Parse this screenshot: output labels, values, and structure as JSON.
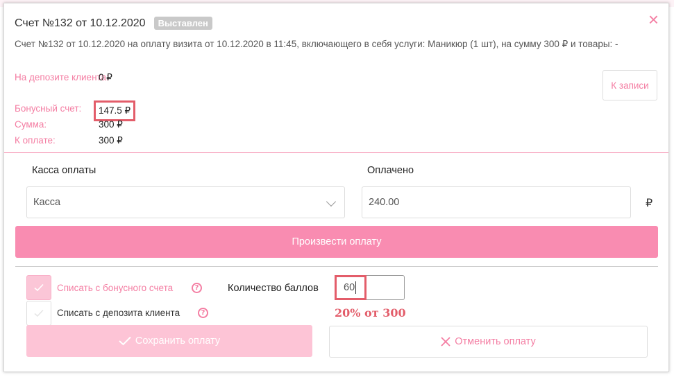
{
  "modal": {
    "title": "Счет №132 от 10.12.2020",
    "status_badge": "Выставлен",
    "close_symbol": "×",
    "description": "Счет №132 от 10.12.2020 на оплату визита от 10.12.2020 в 11:45, включающего в себя услуги: Маникюр (1 шт), на сумму 300 ₽ и товары: -",
    "to_record_button": "К записи"
  },
  "summary": {
    "deposit_label": "На депозите клиента:",
    "deposit_value": "0 ₽",
    "bonus_label": "Бонусный счет:",
    "bonus_value": "147.5 ₽",
    "sum_label": "Сумма:",
    "sum_value": "300 ₽",
    "to_pay_label": "К оплате:",
    "to_pay_value": "300 ₽"
  },
  "payment": {
    "cashbox_label": "Касса оплаты",
    "cashbox_selected": "Касса",
    "paid_label": "Оплачено",
    "paid_value": "240.00",
    "currency": "₽",
    "pay_button": "Произвести оплату"
  },
  "options": {
    "bonus_checkbox_label": "Списать с бонусного счета",
    "bonus_checked": true,
    "deposit_checkbox_label": "Списать с депозита клиента",
    "deposit_checked": false,
    "help_symbol": "?",
    "points_label": "Количество баллов",
    "points_value": "60",
    "annotation": "20% от 300"
  },
  "actions": {
    "save_button": "Сохранить оплату",
    "cancel_button": "Отменить оплату"
  },
  "colors": {
    "accent": "#f47ea3",
    "pay_button": "#f98cb1",
    "save_button_disabled": "#fdc4d6",
    "highlight": "#e35d6a"
  },
  "icons": {
    "close": "close-icon",
    "chevron": "chevron-down-icon",
    "check": "check-icon",
    "help": "question-circle-icon",
    "cancel": "x-icon"
  }
}
